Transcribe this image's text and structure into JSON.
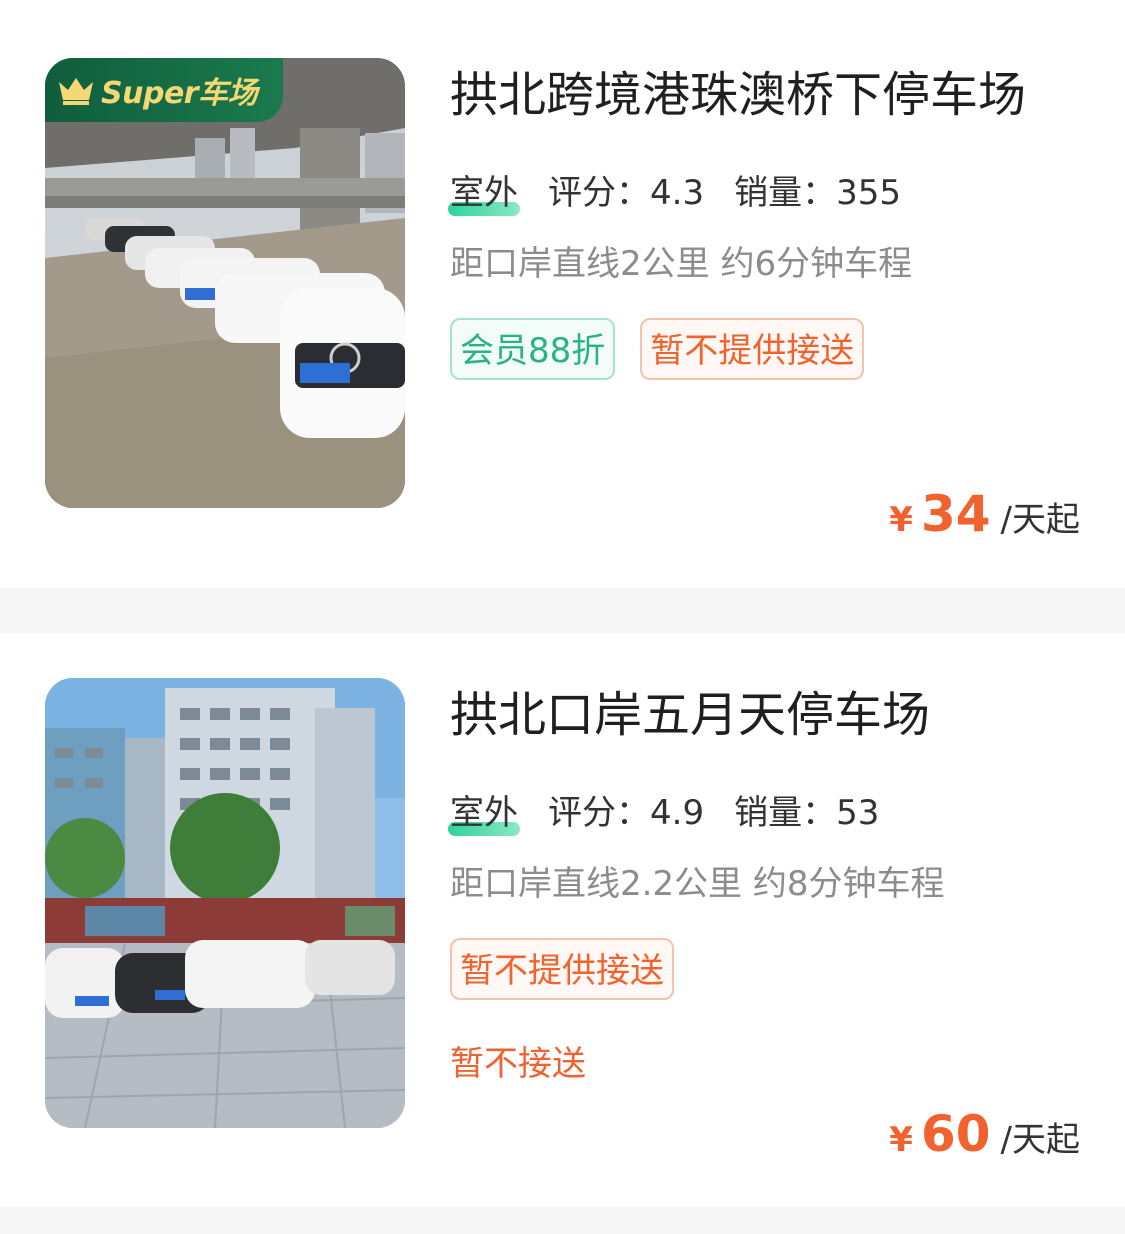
{
  "colors": {
    "accent": "#f2622e",
    "green": "#26b483",
    "badge_bg": "#0f5d3c",
    "badge_text": "#f5d774",
    "separator": "#f6f6f6"
  },
  "listings": [
    {
      "badge": {
        "icon": "crown-icon",
        "text": "Super车场"
      },
      "title": "拱北跨境港珠澳桥下停车场",
      "type": "室外",
      "rating_label": "评分：",
      "rating": "4.3",
      "sales_label": "销量：",
      "sales": "355",
      "distance": "距口岸直线2公里 约6分钟车程",
      "tags": [
        {
          "text": "会员88折",
          "style": "green"
        },
        {
          "text": "暂不提供接送",
          "style": "orange"
        }
      ],
      "note": "",
      "price": {
        "currency": "¥",
        "amount": "34",
        "unit": "/天起"
      }
    },
    {
      "badge": null,
      "title": "拱北口岸五月天停车场",
      "type": "室外",
      "rating_label": "评分：",
      "rating": "4.9",
      "sales_label": "销量：",
      "sales": "53",
      "distance": "距口岸直线2.2公里 约8分钟车程",
      "tags": [
        {
          "text": "暂不提供接送",
          "style": "orange"
        }
      ],
      "note": "暂不接送",
      "price": {
        "currency": "¥",
        "amount": "60",
        "unit": "/天起"
      }
    }
  ]
}
